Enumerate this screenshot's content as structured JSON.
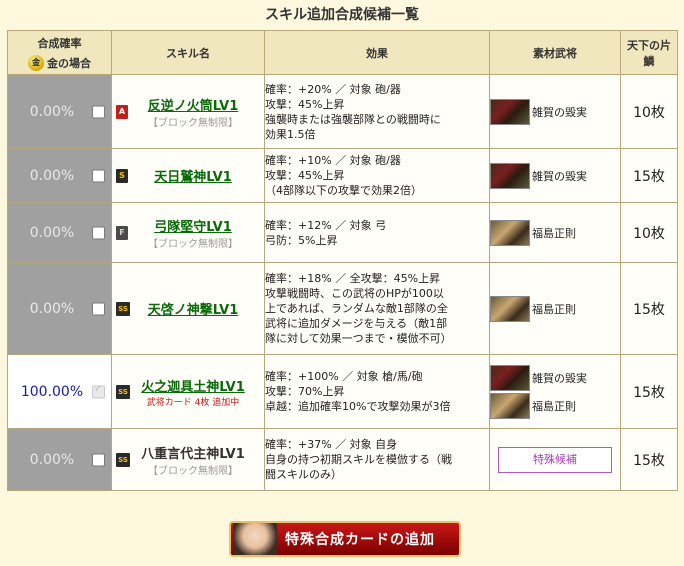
{
  "title": "スキル追加合成候補一覧",
  "headers": {
    "rate": "合成確率",
    "gold_label": "金の場合",
    "gold_icon_text": "金",
    "skill": "スキル名",
    "effect": "効果",
    "material": "素材武将",
    "cost": "天下の片鱗"
  },
  "rows": [
    {
      "rate": "0.00%",
      "checked": false,
      "rank": "A",
      "skill_name": "反逆ノ火筒LV1",
      "skill_sub": "【ブロック無制限】",
      "effect": [
        "確率：+20% ／ 対象 砲/器",
        "攻撃：45%上昇",
        "強襲時または強襲部隊との戦闘時に",
        "効果1.5倍"
      ],
      "materials": [
        "雑賀の毀実"
      ],
      "cost": "10枚"
    },
    {
      "rate": "0.00%",
      "checked": false,
      "rank": "S",
      "skill_name": "天日鷲神LV1",
      "skill_sub": "",
      "effect": [
        "確率：+10% ／ 対象 砲/器",
        "攻撃：45%上昇",
        "（4部隊以下の攻撃で効果2倍）"
      ],
      "materials": [
        "雑賀の毀実"
      ],
      "cost": "15枚"
    },
    {
      "rate": "0.00%",
      "checked": false,
      "rank": "F",
      "skill_name": "弓隊堅守LV1",
      "skill_sub": "【ブロック無制限】",
      "effect": [
        "確率：+12% ／ 対象 弓",
        "弓防：5%上昇"
      ],
      "materials": [
        "福島正則"
      ],
      "cost": "10枚"
    },
    {
      "rate": "0.00%",
      "checked": false,
      "rank": "SS",
      "skill_name": "天啓ノ神撃LV1",
      "skill_sub": "",
      "effect": [
        "確率：+18% ／ 全攻撃：45%上昇",
        "攻撃戦闘時、この武将のHPが100以",
        "上であれば、ランダムな敵1部隊の全",
        "武将に追加ダメージを与える（敵1部",
        "隊に対して効果一つまで・模倣不可）"
      ],
      "materials": [
        "福島正則"
      ],
      "cost": "15枚"
    },
    {
      "rate": "100.00%",
      "checked": true,
      "rank": "SS",
      "skill_name": "火之迦具土神LV1",
      "skill_sub": "武将カード 4枚 追加中",
      "effect": [
        "確率：+100% ／ 対象 槍/馬/砲",
        "攻撃：70%上昇",
        "卓越：追加確率10%で攻撃効果が3倍"
      ],
      "materials": [
        "雑賀の毀実",
        "福島正則"
      ],
      "cost": "15枚"
    },
    {
      "rate": "0.00%",
      "checked": false,
      "rank": "SS",
      "skill_name": "八重言代主神LV1",
      "skill_sub": "【ブロック無制限】",
      "effect": [
        "確率：+37% ／ 対象 自身",
        "自身の持つ初期スキルを模倣する（戦",
        "闘スキルのみ）"
      ],
      "special": "特殊候補",
      "cost": "15枚"
    }
  ],
  "add_button": "特殊合成カードの追加"
}
